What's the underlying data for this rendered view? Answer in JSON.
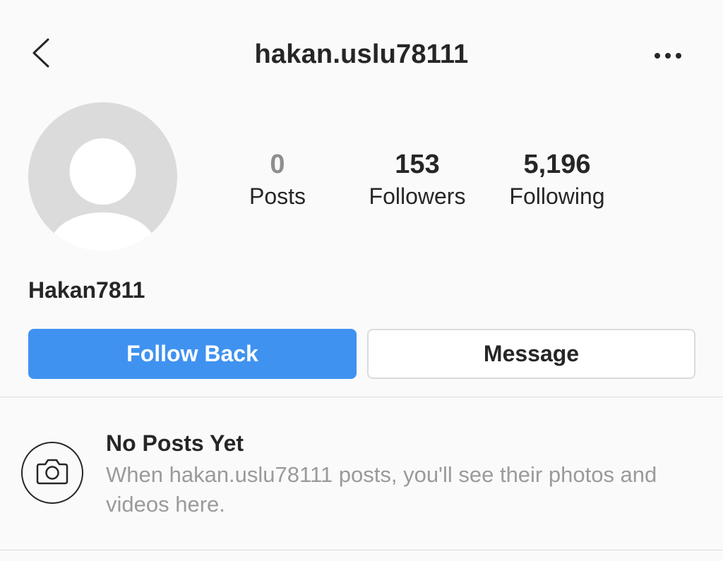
{
  "header": {
    "back_icon": "chevron-left-icon",
    "username": "hakan.uslu78111",
    "more_icon": "more-horizontal-icon"
  },
  "profile": {
    "avatar_icon": "default-avatar-icon",
    "stats": {
      "posts": {
        "value": "0",
        "label": "Posts"
      },
      "followers": {
        "value": "153",
        "label": "Followers"
      },
      "following": {
        "value": "5,196",
        "label": "Following"
      }
    },
    "display_name": "Hakan7811"
  },
  "actions": {
    "follow_back_label": "Follow Back",
    "message_label": "Message"
  },
  "empty_state": {
    "icon": "camera-icon",
    "title": "No Posts Yet",
    "description": "When hakan.uslu78111 posts, you'll see their photos and videos here."
  },
  "colors": {
    "accent": "#3f92f0",
    "text": "#262626",
    "muted_text": "#9a9a9a",
    "background": "#fafafa",
    "divider": "#dbdbdb"
  }
}
